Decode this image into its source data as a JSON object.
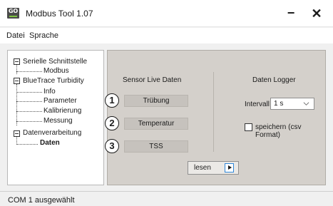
{
  "window": {
    "title": "Modbus Tool 1.07",
    "icon_text": "GO",
    "minimize_glyph": "−",
    "close_glyph": "✕"
  },
  "menu": {
    "items": [
      {
        "label": "Datei"
      },
      {
        "label": "Sprache"
      }
    ]
  },
  "tree": {
    "nodes": [
      {
        "label": "Serielle Schnittstelle",
        "expanded": true
      },
      {
        "label": "Modbus"
      },
      {
        "label": "BlueTrace Turbidity",
        "expanded": true
      },
      {
        "label": "Info"
      },
      {
        "label": "Parameter"
      },
      {
        "label": "Kalibrierung"
      },
      {
        "label": "Messung"
      },
      {
        "label": "Datenverarbeitung",
        "expanded": true
      },
      {
        "label": "Daten",
        "selected": true
      }
    ]
  },
  "sensor": {
    "title": "Sensor Live Daten",
    "buttons": [
      {
        "number": "1",
        "label": "Trübung"
      },
      {
        "number": "2",
        "label": "Temperatur"
      },
      {
        "number": "3",
        "label": "TSS"
      }
    ]
  },
  "logger": {
    "title": "Daten Logger",
    "intervall_label": "Intervall",
    "intervall_value": "1 s",
    "save_label": "speichern (csv Format)",
    "save_checked": false
  },
  "read_button": {
    "label": "lesen"
  },
  "status": {
    "text": "COM 1 ausgewählt"
  },
  "colors": {
    "panel_bg": "#d4d0cb",
    "sensor_button_bg": "#c6c2bd",
    "accent_blue": "#2e86d8",
    "icon_green": "#7ec241"
  }
}
